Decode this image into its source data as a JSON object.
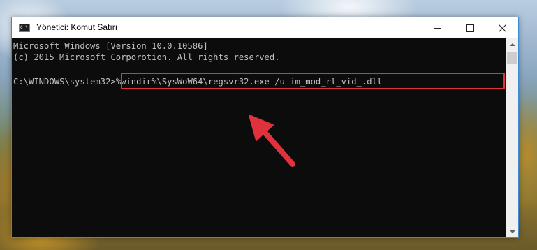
{
  "window": {
    "title": "Yönetici: Komut Satırı",
    "icon": "cmd-icon",
    "app_icon_text": "C:\\",
    "controls": {
      "minimize": "minimize-icon",
      "maximize": "maximize-icon",
      "close": "close-icon",
      "close_glyph": "✕"
    }
  },
  "console": {
    "line1": "Microsoft Windows [Version 10.0.10586]",
    "line2": "(c) 2015 Microsoft Corporotion. All rights reserved.",
    "prompt": "C:\\WINDOWS\\system32>",
    "command": "%windir%\\SysWoW64\\regsvr32.exe /u im_mod_rl_vid_.dll"
  },
  "colors": {
    "console_bg": "#0c0c0c",
    "console_text": "#c0c0c0",
    "highlight": "#e0323c",
    "window_border": "#3d8ad6"
  }
}
